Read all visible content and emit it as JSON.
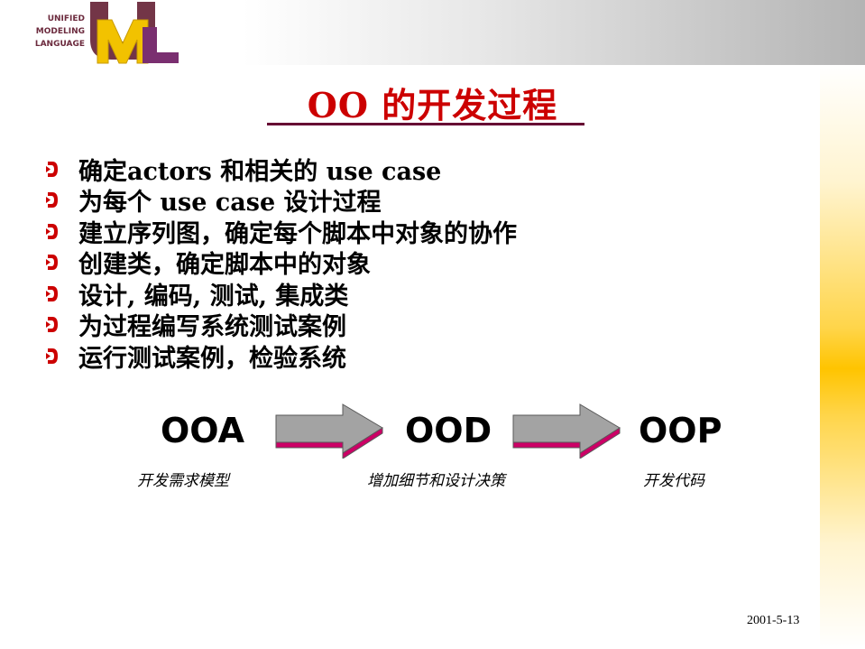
{
  "logo": {
    "lines": [
      "UNIFIED",
      "MODELING",
      "LANGUAGE"
    ],
    "letters": [
      "U",
      "M",
      "L"
    ]
  },
  "title": "OO 的开发过程",
  "bullets": [
    "确定actors 和相关的 use case",
    "为每个 use case 设计过程",
    "建立序列图，确定每个脚本中对象的协作",
    "创建类，确定脚本中的对象",
    "设计, 编码, 测试, 集成类",
    "为过程编写系统测试案例",
    "运行测试案例，检验系统"
  ],
  "phases": [
    {
      "label": "OOA",
      "desc": "开发需求模型"
    },
    {
      "label": "OOD",
      "desc": "增加细节和设计决策"
    },
    {
      "label": "OOP",
      "desc": "开发代码"
    }
  ],
  "footer": {
    "date": "2001-5-13"
  },
  "colors": {
    "title": "#cc0000",
    "underline": "#660033",
    "bullet": "#cc0000",
    "arrow_face": "#a3a3a3",
    "arrow_edge": "#cc0066",
    "logo_u": "#6b2a3d",
    "logo_m": "#f2c200",
    "logo_l": "#7a2f70"
  }
}
